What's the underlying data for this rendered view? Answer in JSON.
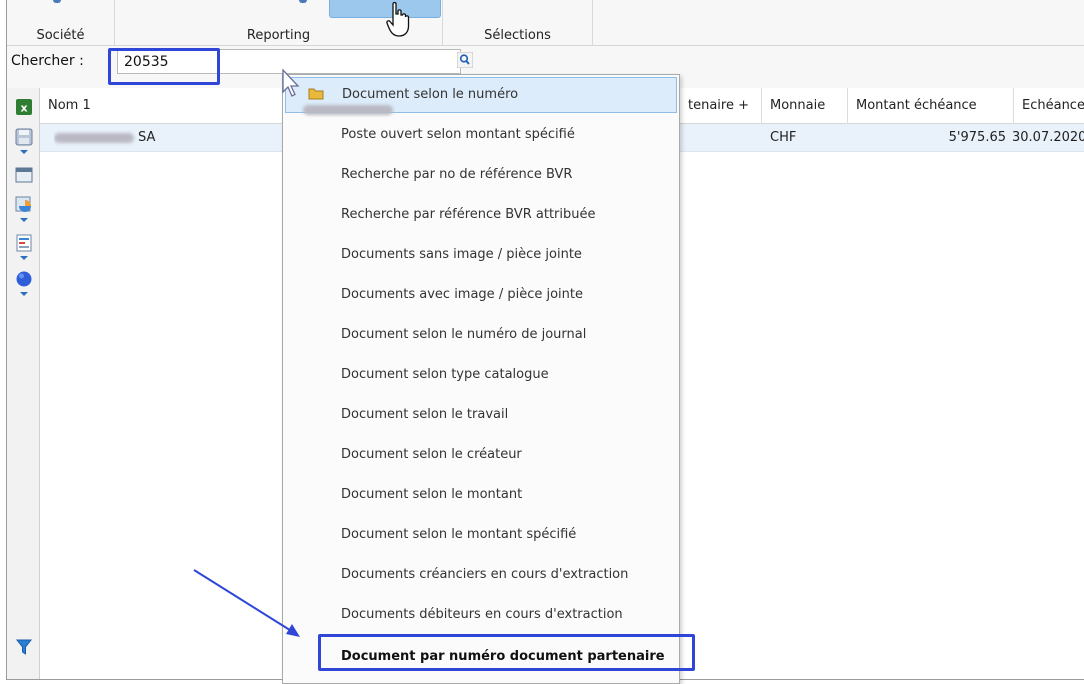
{
  "ribbon": {
    "groups": [
      {
        "label": "Société"
      },
      {
        "label": "Reporting"
      },
      {
        "label": "Sélections"
      }
    ]
  },
  "search": {
    "label": "Chercher :",
    "value": "20535"
  },
  "grid": {
    "columns": [
      "Nom 1",
      "tenaire +",
      "Monnaie",
      "Montant échéance",
      "Echéance"
    ],
    "rows": [
      {
        "name_suffix": "SA",
        "currency": "CHF",
        "amount": "5'975.65",
        "due": "30.07.2020"
      }
    ]
  },
  "menu": {
    "items": [
      "Document selon le numéro",
      "Poste ouvert selon montant spécifié",
      "Recherche par no de référence BVR",
      "Recherche par référence BVR attribuée",
      "Documents sans image / pièce jointe",
      "Documents avec image / pièce jointe",
      "Document selon le numéro de journal",
      "Document selon type catalogue",
      "Document selon le travail",
      "Document selon le créateur",
      "Document selon le montant",
      "Document selon le montant spécifié",
      "Documents créanciers en cours d'extraction",
      "Documents débiteurs en cours d'extraction",
      "Document par numéro document partenaire"
    ],
    "hovered_index": 0,
    "highlighted_index": 14
  },
  "colors": {
    "highlight_box": "#2f46d6",
    "arrow": "#2f46d6",
    "menu_hover": "#dcecfb",
    "row_selected": "#e9f1fb"
  },
  "icons": [
    "excel-icon",
    "save-icon",
    "window-icon",
    "chart-icon",
    "report-icon",
    "sphere-icon",
    "filter-icon",
    "search-icon",
    "folder-icon",
    "hand-cursor-icon",
    "arrow-cursor-icon"
  ]
}
